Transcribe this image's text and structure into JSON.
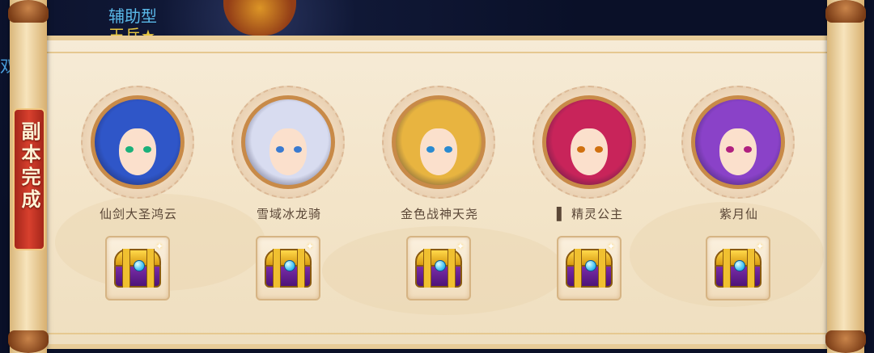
{
  "background": {
    "tag_type": "辅助型",
    "tag_stars": "王兵★",
    "side_text": "双\n男"
  },
  "banner": {
    "text": "副本完成"
  },
  "heroes": [
    {
      "name": "仙剑大圣鸿云",
      "hair": "#2f56c8",
      "eyes": "#1bb07a",
      "chest_icon": "treasure-chest-icon"
    },
    {
      "name": "雪域冰龙骑",
      "hair": "#d8dcf0",
      "eyes": "#3a7ad0",
      "chest_icon": "treasure-chest-icon"
    },
    {
      "name": "金色战神天尧",
      "hair": "#e8b440",
      "eyes": "#2a8ad0",
      "chest_icon": "treasure-chest-icon"
    },
    {
      "name": "▌ 精灵公主",
      "hair": "#c8245a",
      "eyes": "#d07010",
      "chest_icon": "treasure-chest-icon"
    },
    {
      "name": "紫月仙",
      "hair": "#8a42c8",
      "eyes": "#b02080",
      "chest_icon": "treasure-chest-icon"
    }
  ],
  "colors": {
    "scroll_paper": "#f6ebd6",
    "banner_red": "#d8402e",
    "avatar_border": "#c88a48"
  }
}
